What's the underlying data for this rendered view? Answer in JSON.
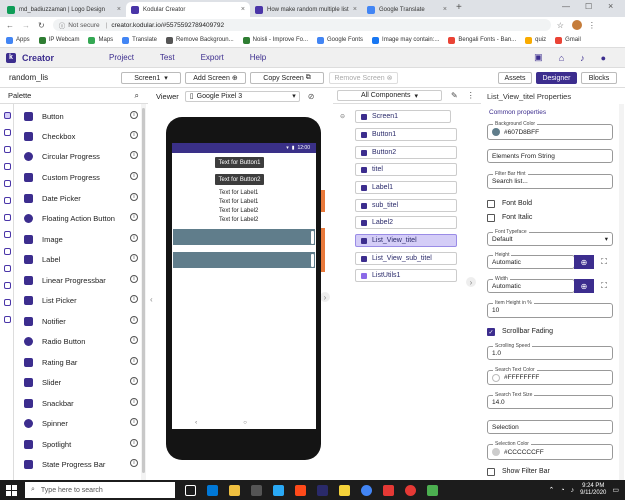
{
  "browser": {
    "tabs": [
      {
        "label": "md_badiuzzaman | Logo Design",
        "color": "#0f9d58"
      },
      {
        "label": "Kodular Creator",
        "color": "#4a35a8"
      },
      {
        "label": "How make random multiple list",
        "color": "#4a35a8"
      },
      {
        "label": "Google Translate",
        "color": "#4285f4"
      }
    ],
    "security": "Not secure",
    "url": "creator.kodular.io/#5575592789409792",
    "bookmarks": [
      {
        "label": "Apps",
        "color": "#4285f4"
      },
      {
        "label": "IP Webcam",
        "color": "#2e7d32"
      },
      {
        "label": "Maps",
        "color": "#34a853"
      },
      {
        "label": "Translate",
        "color": "#4285f4"
      },
      {
        "label": "Remove Backgroun...",
        "color": "#555555"
      },
      {
        "label": "Noisli - Improve Fo...",
        "color": "#2e7d32"
      },
      {
        "label": "Google Fonts",
        "color": "#4285f4"
      },
      {
        "label": "Image may contain:...",
        "color": "#1877f2"
      },
      {
        "label": "Bengali Fonts - Ban...",
        "color": "#ea4335"
      },
      {
        "label": "quiz",
        "color": "#f9ab00"
      },
      {
        "label": "Gmail",
        "color": "#ea4335"
      }
    ]
  },
  "app": {
    "brand": "Creator",
    "menu": [
      "Project",
      "Test",
      "Export",
      "Help"
    ],
    "project_name": "random_lis",
    "screen_select": "Screen1",
    "add_screen": "Add Screen",
    "copy_screen": "Copy Screen",
    "remove_screen": "Remove Screen",
    "assets": "Assets",
    "designer": "Designer",
    "blocks": "Blocks",
    "accent": "#3c2d8e"
  },
  "palette": {
    "title": "Palette",
    "items": [
      "Button",
      "Checkbox",
      "Circular Progress",
      "Custom Progress",
      "Date Picker",
      "Floating Action Button",
      "Image",
      "Label",
      "Linear Progressbar",
      "List Picker",
      "Notifier",
      "Radio Button",
      "Rating Bar",
      "Slider",
      "Snackbar",
      "Spinner",
      "Spotlight",
      "State Progress Bar"
    ]
  },
  "viewer": {
    "title": "Viewer",
    "device": "Google Pixel 3",
    "time": "12:00",
    "buttons": [
      "Text for Button1",
      "Text for Button2"
    ],
    "labels": [
      "Text for Label1",
      "Text for Label1",
      "Text for Label2",
      "Text for Label2"
    ],
    "list_color": "#607d8b"
  },
  "components": {
    "title": "All Components",
    "items": [
      "Screen1",
      "Button1",
      "Button2",
      "titel",
      "Label1",
      "sub_titel",
      "Label2",
      "List_View_titel",
      "List_View_sub_titel",
      "ListUtils1"
    ]
  },
  "properties": {
    "title": "List_View_titel Properties",
    "section": "Common properties",
    "background_color_label": "Background Color",
    "background_color": "#607D8BFF",
    "elements_from_string": "Elements From String",
    "filter_bar_hint_label": "Filter Bar Hint",
    "filter_bar_hint": "Search list...",
    "font_bold": "Font Bold",
    "font_italic": "Font Italic",
    "font_typeface_label": "Font Typeface",
    "font_typeface": "Default",
    "height_label": "Height",
    "height": "Automatic",
    "width_label": "Width",
    "width": "Automatic",
    "item_height_label": "Item Height in %",
    "item_height": "10",
    "scrollbar_fading": "Scrollbar Fading",
    "scrolling_speed_label": "Scrolling Speed",
    "scrolling_speed": "1.0",
    "search_text_color_label": "Search Text Color",
    "search_text_color": "#FFFFFFFF",
    "search_text_size_label": "Search Text Size",
    "search_text_size": "14.0",
    "selection": "Selection",
    "selection_color_label": "Selection Color",
    "selection_color": "#CCCCCCFF",
    "show_filter_bar": "Show Filter Bar"
  },
  "taskbar": {
    "search_placeholder": "Type here to search",
    "time": "9:24 PM",
    "date": "9/11/2020"
  }
}
